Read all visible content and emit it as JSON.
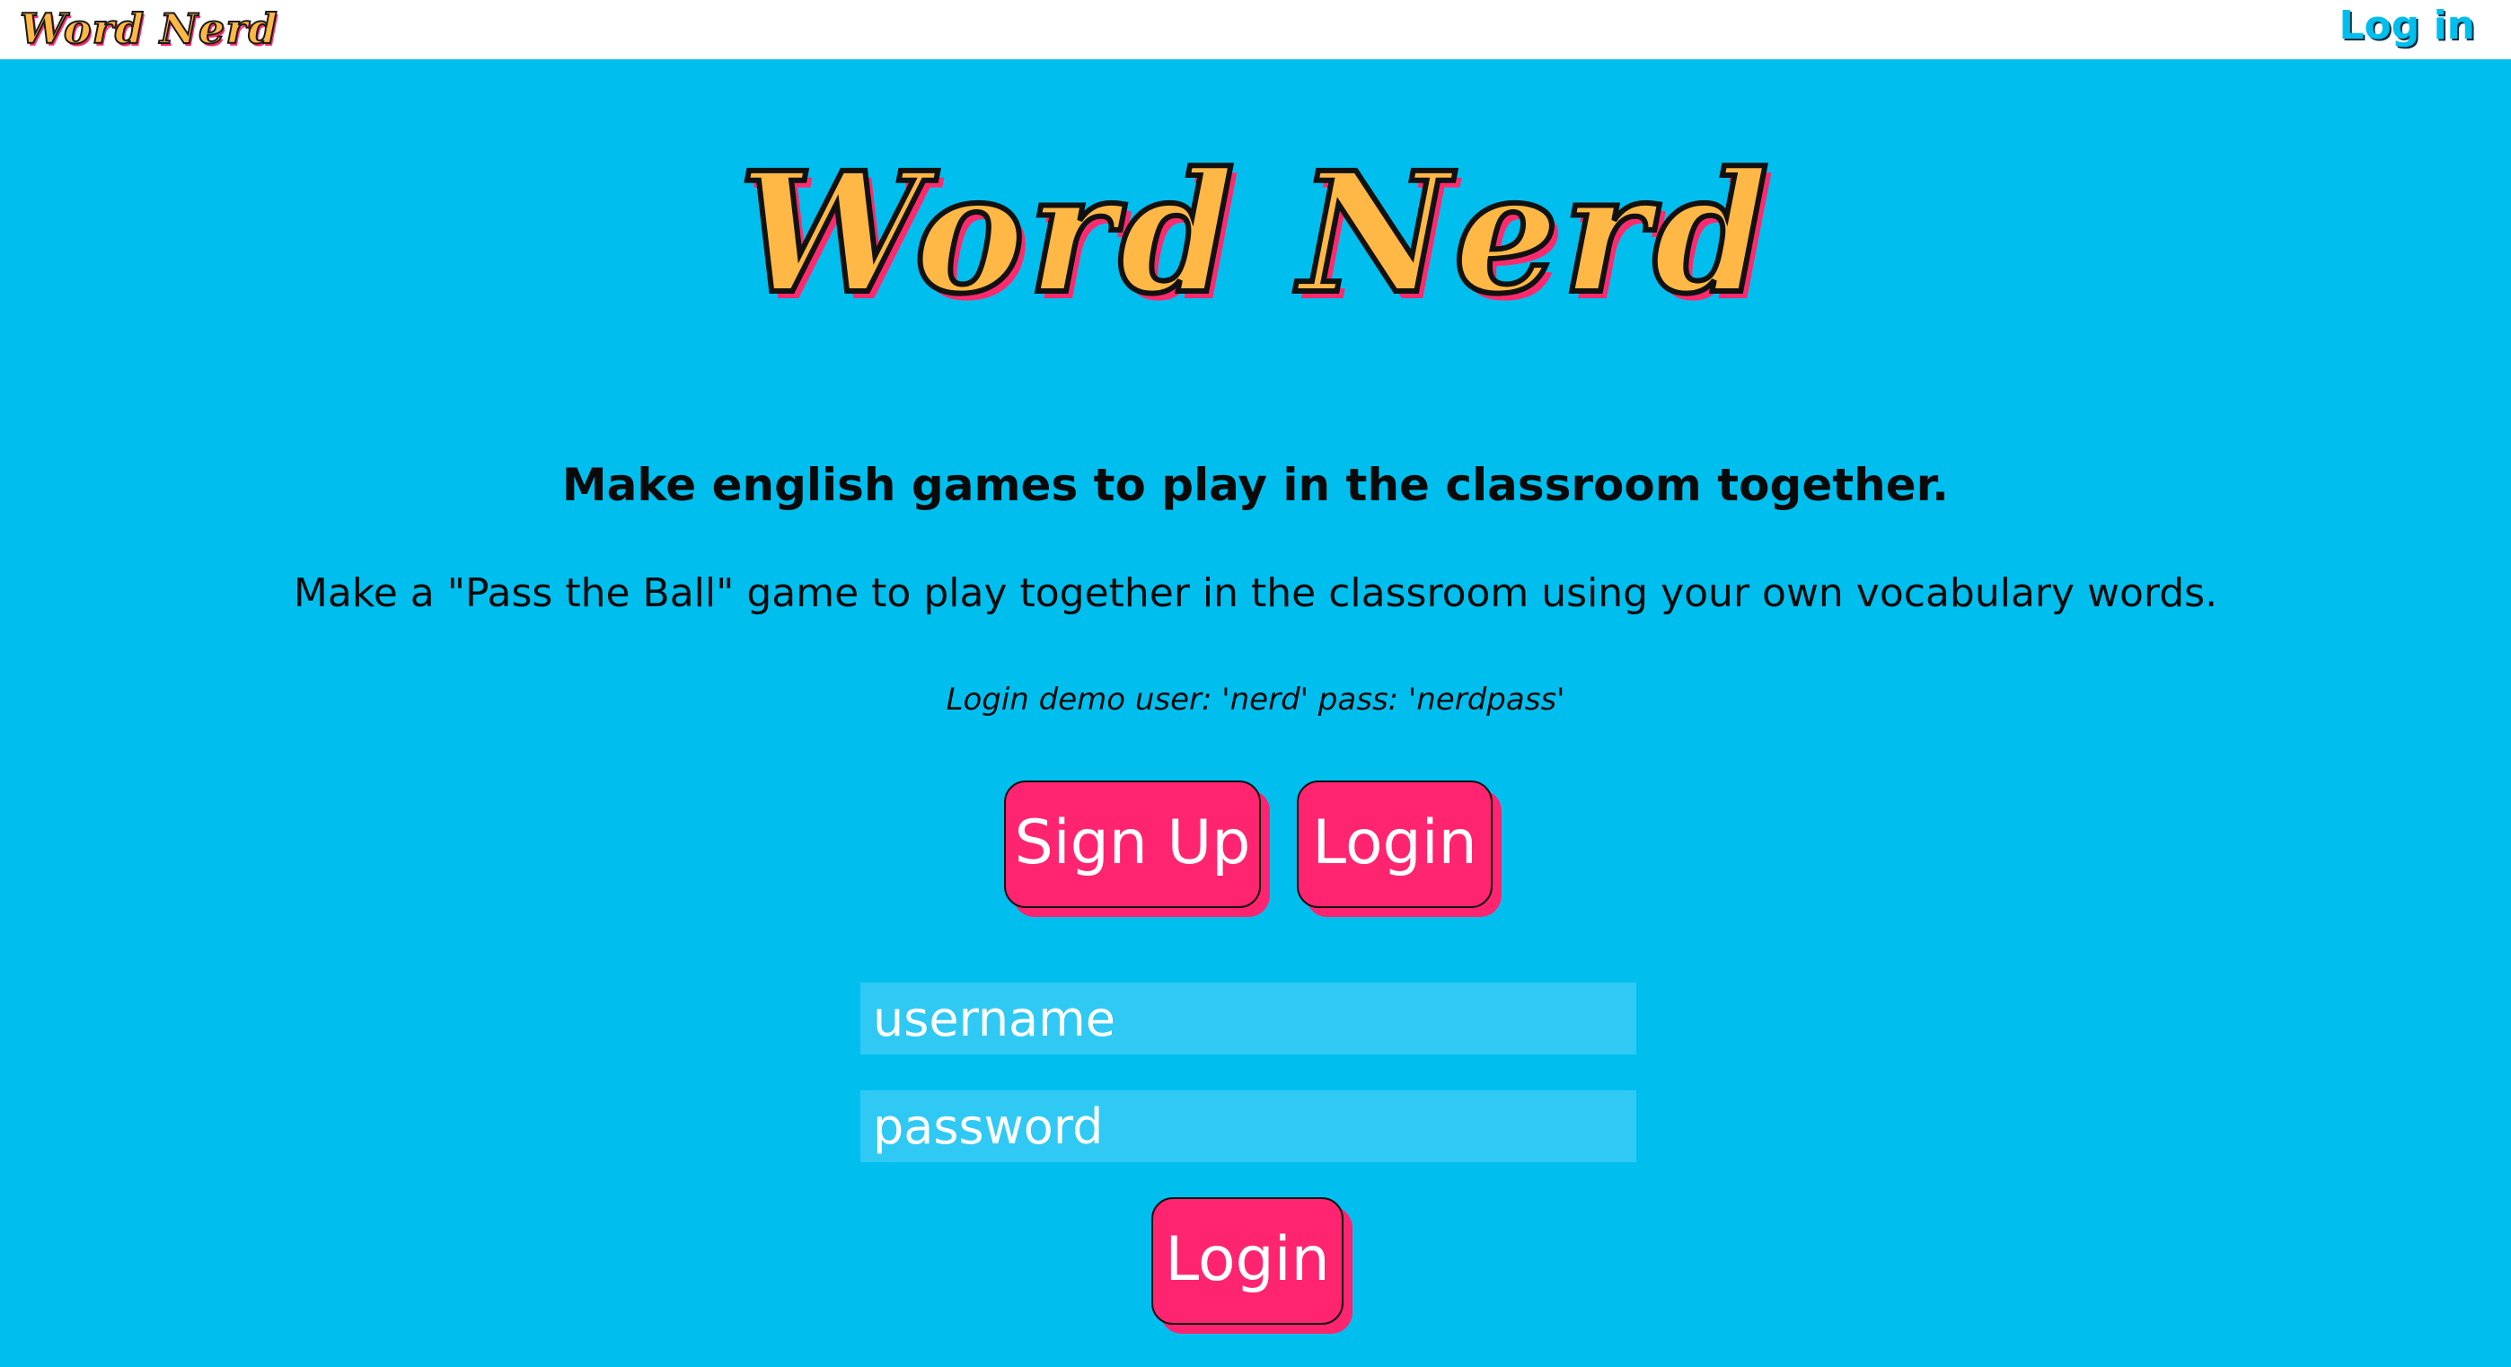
{
  "nav": {
    "logo": "Word Nerd",
    "login_link": "Log in"
  },
  "hero": {
    "title": "Word Nerd",
    "tagline": "Make english games to play in the classroom together.",
    "description": "Make a \"Pass the Ball\" game to play together in the classroom using your own vocabulary words.",
    "demo_note": "Login demo user: 'nerd' pass: 'nerdpass'"
  },
  "actions": {
    "signup_label": "Sign Up",
    "login_label": "Login"
  },
  "form": {
    "username_placeholder": "username",
    "password_placeholder": "password",
    "submit_label": "Login"
  },
  "colors": {
    "background": "#00bfee",
    "brand_yellow": "#ffb845",
    "accent_pink": "#ff2470",
    "field_bg": "#30c9f4"
  }
}
